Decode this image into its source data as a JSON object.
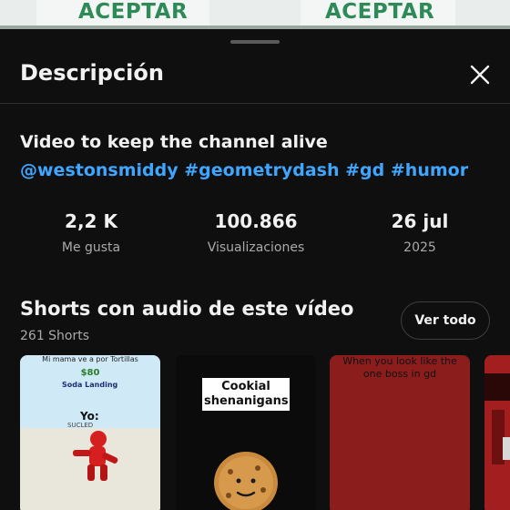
{
  "background_video": {
    "button_left": "ACEPTAR",
    "button_right": "ACEPTAR"
  },
  "sheet": {
    "title": "Descripción",
    "close_icon": "close-icon"
  },
  "description": {
    "title": "Video to keep the channel alive",
    "tags": [
      "@westonsmiddy",
      "#geometrydash",
      "#gd",
      "#humor"
    ]
  },
  "stats": [
    {
      "value": "2,2 K",
      "label": "Me gusta"
    },
    {
      "value": "100.866",
      "label": "Visualizaciones"
    },
    {
      "value": "26 jul",
      "label": "2025"
    }
  ],
  "shorts_section": {
    "title": "Shorts con audio de este vídeo",
    "count": "261 Shorts",
    "see_all_label": "Ver todo"
  },
  "thumbnails": [
    {
      "caption": "Mi mama ve a por Tortillas",
      "price": "$80",
      "brand": "Soda Landing",
      "name": "Yo:",
      "small": "SUCLED"
    },
    {
      "label": "Cookial shenanigans"
    },
    {
      "label": "When you look like the one boss in gd"
    }
  ],
  "colors": {
    "background": "#0f0f0f",
    "link": "#3ea6ff",
    "secondary_text": "#aaaaaa",
    "accept_green": "#2e8b57"
  }
}
